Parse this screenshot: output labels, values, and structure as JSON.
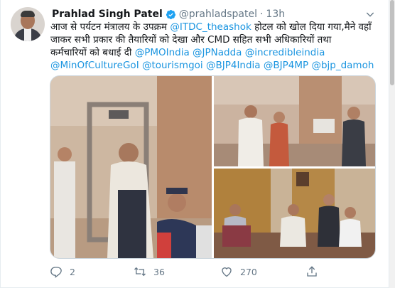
{
  "tweet": {
    "name": "Prahlad Singh Patel",
    "handle": "@prahladspatel",
    "separator": "·",
    "time": "13h",
    "text_line1_a": "आज से पर्यटन मंत्रालय के उपक्रम ",
    "text_line1_link": "@ITDC_theashok",
    "text_line1_b": " होटल को खोल दिया गया,मैने वहाँ",
    "text_line2": "जाकर सभी प्रकार की तैयारियों को देखा और CMD सहित सभी अधिकारियों तथा",
    "text_line3_a": "कर्मचारियों को बधाई दी ",
    "mentions_line3": [
      "@PMOIndia",
      "@JPNadda",
      "@incredibleindia"
    ],
    "mentions_line4": [
      "@MinOfCultureGoI",
      "@tourismgoi",
      "@BJP4India",
      "@BJP4MP",
      "@bjp_damoh"
    ]
  },
  "actions": {
    "reply_count": "2",
    "retweet_count": "36",
    "like_count": "270"
  },
  "icons": {
    "verified": "verified-badge-icon",
    "more": "chevron-down-icon",
    "reply": "reply-icon",
    "retweet": "retweet-icon",
    "like": "heart-icon",
    "share": "share-icon"
  },
  "colors": {
    "link": "#1b95e0",
    "muted": "#657786",
    "verified": "#1da1f2"
  }
}
